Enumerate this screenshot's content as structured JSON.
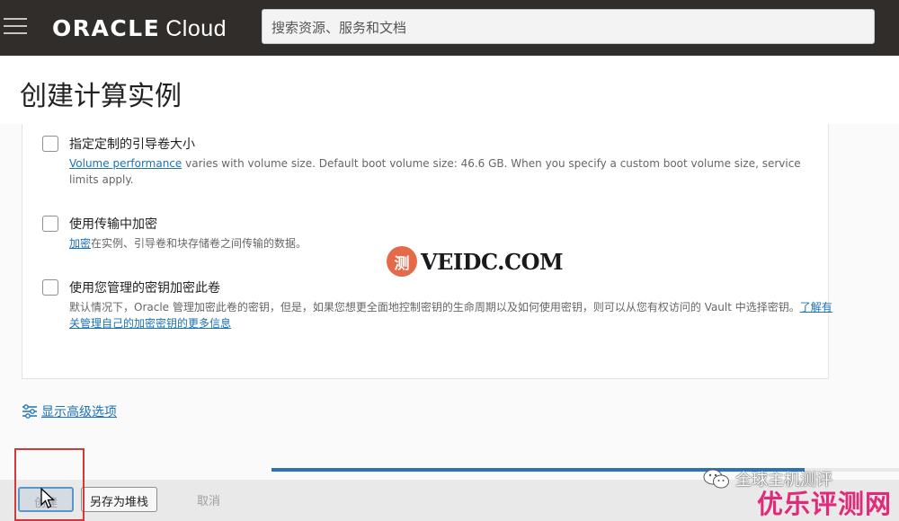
{
  "brand": {
    "oracle": "ORACLE",
    "cloud": "Cloud"
  },
  "search": {
    "placeholder": "搜索资源、服务和文档"
  },
  "page": {
    "title": "创建计算实例"
  },
  "options": [
    {
      "label": "指定定制的引导卷大小",
      "link": "Volume performance",
      "desc": " varies with volume size. Default boot volume size: 46.6 GB. When you specify a custom boot volume size, service limits apply."
    },
    {
      "label": "使用传输中加密",
      "link": "加密",
      "desc": "在实例、引导卷和块存储卷之间传输的数据。"
    },
    {
      "label": "使用您管理的密钥加密此卷",
      "desc": "默认情况下，Oracle 管理加密此卷的密钥，但是，如果您想更全面地控制密钥的生命周期以及如何使用密钥，则可以从您有权访问的 Vault 中选择密钥。",
      "link": "了解有关管理自己的加密密钥的更多信息"
    }
  ],
  "advanced": {
    "label": "显示高级选项"
  },
  "buttons": {
    "create": "创建",
    "save_stack": "另存为堆栈",
    "cancel": "取消"
  },
  "progress": {
    "fraction": 0.85
  },
  "watermarks": {
    "veidc_badge": "测",
    "veidc": "VEIDC.COM",
    "wechat": "全球主机测评",
    "site": "优乐评测网"
  },
  "colors": {
    "topbar": "#312d2a",
    "link": "#1b72b8",
    "highlight": "#d23a3a",
    "site_watermark": "#e02a7a"
  }
}
